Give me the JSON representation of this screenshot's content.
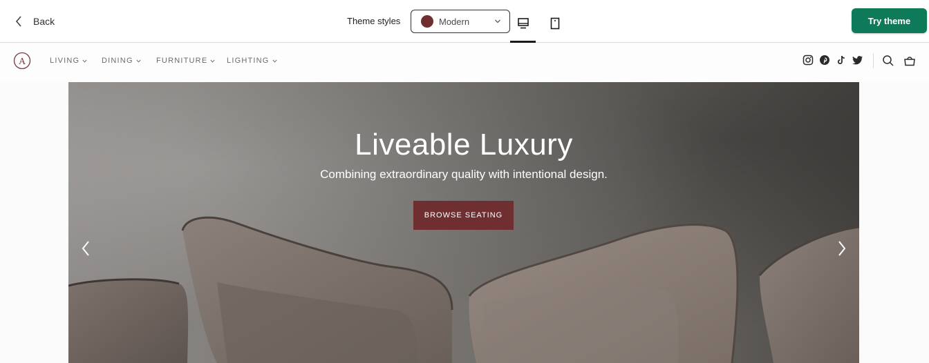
{
  "topbar": {
    "back_label": "Back",
    "theme_styles_label": "Theme styles",
    "theme_style": {
      "value": "Modern",
      "swatch_color": "#6f2f31"
    },
    "try_theme_label": "Try theme",
    "accent_color": "#0f7a5a"
  },
  "storenav": {
    "logo_letter": "A",
    "menu": [
      {
        "label": "LIVING"
      },
      {
        "label": "DINING"
      },
      {
        "label": "FURNITURE"
      },
      {
        "label": "LIGHTING"
      }
    ],
    "social_icons": [
      "instagram-icon",
      "pinterest-icon",
      "tiktok-icon",
      "twitter-icon"
    ],
    "utility_icons": [
      "search-icon",
      "cart-icon"
    ]
  },
  "hero": {
    "title": "Liveable Luxury",
    "subtitle": "Combining extraordinary quality with intentional design.",
    "cta_label": "BROWSE SEATING",
    "cta_color": "#6f2f31"
  }
}
